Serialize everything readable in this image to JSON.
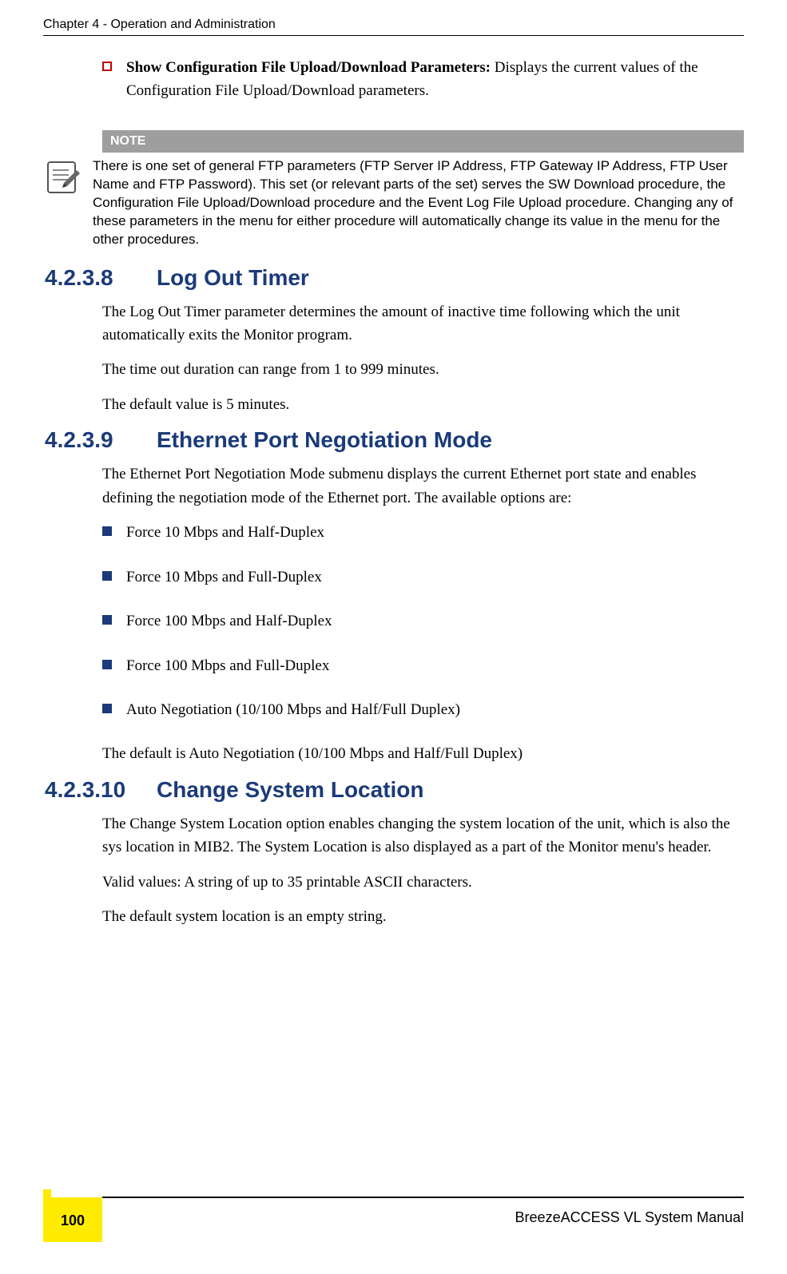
{
  "header": {
    "chapter": "Chapter 4 - Operation and Administration"
  },
  "intro_bullet": {
    "title": "Show Configuration File Upload/Download Parameters:",
    "text": " Displays the current values of the Configuration File Upload/Download parameters."
  },
  "note": {
    "label": "NOTE",
    "text": "There is one set of general FTP parameters (FTP Server IP Address, FTP Gateway IP Address, FTP User Name and FTP Password). This set (or relevant parts of the set) serves the SW Download procedure, the Configuration File Upload/Download procedure and the Event Log File Upload procedure. Changing any of these parameters in the menu for either procedure will automatically change its value in the menu for the other procedures."
  },
  "sections": [
    {
      "num": "4.2.3.8",
      "title": "Log Out Timer",
      "paras": [
        "The Log Out Timer parameter determines the amount of inactive time following which the unit automatically exits the Monitor program.",
        "The time out duration can range from 1 to 999 minutes.",
        "The default value is 5 minutes."
      ]
    },
    {
      "num": "4.2.3.9",
      "title": "Ethernet Port Negotiation Mode",
      "paras": [
        "The Ethernet Port Negotiation Mode submenu displays the current Ethernet port state and enables defining the negotiation mode of the Ethernet port. The available options are:"
      ],
      "options": [
        "Force 10 Mbps and Half-Duplex",
        "Force 10 Mbps and Full-Duplex",
        "Force 100 Mbps and Half-Duplex",
        "Force 100 Mbps and Full-Duplex",
        "Auto Negotiation (10/100 Mbps and Half/Full Duplex)"
      ],
      "after": [
        "The default is Auto Negotiation (10/100 Mbps and Half/Full Duplex)"
      ]
    },
    {
      "num": "4.2.3.10",
      "title": "Change System Location",
      "paras": [
        "The Change System Location option enables changing the system location of the unit, which is also the sys location in MIB2. The System Location is also displayed as a part of the Monitor menu's header.",
        "Valid values: A string of up to 35 printable ASCII characters.",
        "The default system location is an empty string."
      ]
    }
  ],
  "footer": {
    "manual": "BreezeACCESS VL System Manual",
    "page": "100"
  }
}
